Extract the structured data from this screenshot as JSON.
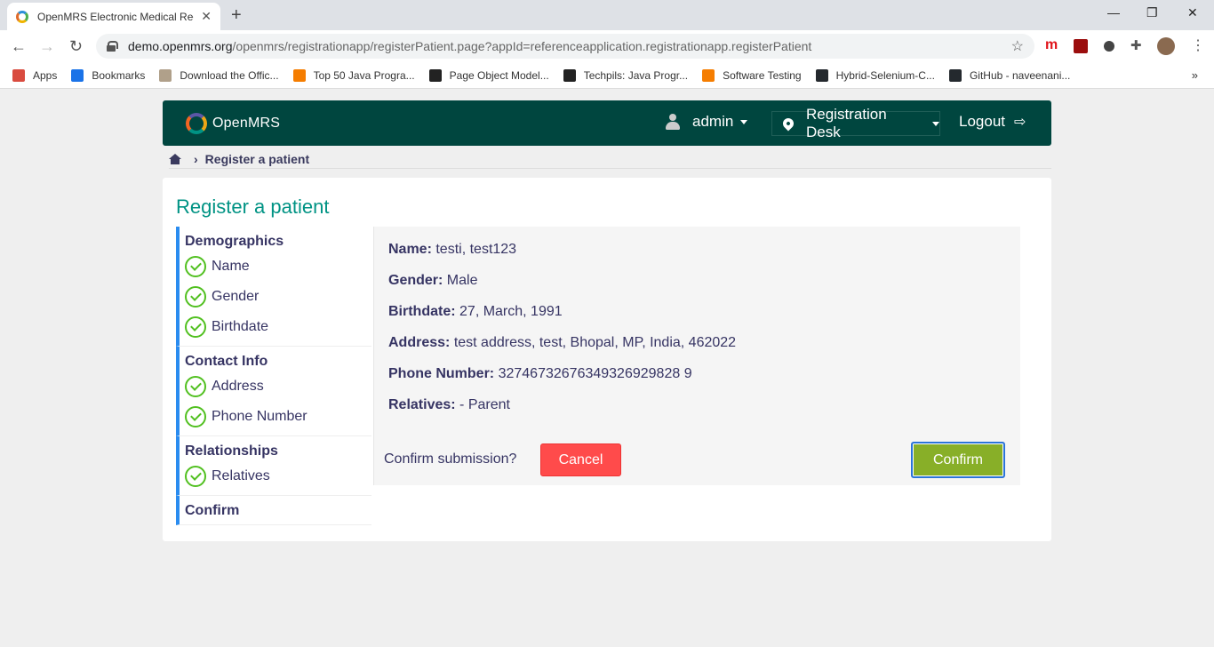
{
  "browser": {
    "tab_title": "OpenMRS Electronic Medical Rec",
    "url_host": "demo.openmrs.org",
    "url_path": "/openmrs/registrationapp/registerPatient.page?appId=referenceapplication.registrationapp.registerPatient",
    "bookmarks": [
      {
        "label": "Apps",
        "icon": "apps-grid-icon",
        "color": "#d94b3f"
      },
      {
        "label": "Bookmarks",
        "icon": "star-icon",
        "color": "#1a73e8"
      },
      {
        "label": "Download the Offic...",
        "icon": "document-icon",
        "color": "#b0a08a"
      },
      {
        "label": "Top 50 Java Progra...",
        "icon": "blogger-icon",
        "color": "#f57d00"
      },
      {
        "label": "Page Object Model...",
        "icon": "8th-icon",
        "color": "#222222"
      },
      {
        "label": "Techpils: Java Progr...",
        "icon": "t-icon",
        "color": "#222222"
      },
      {
        "label": "Software Testing",
        "icon": "blogger-icon",
        "color": "#f57d00"
      },
      {
        "label": "Hybrid-Selenium-C...",
        "icon": "github-icon",
        "color": "#24292e"
      },
      {
        "label": "GitHub - naveenani...",
        "icon": "github-icon",
        "color": "#24292e"
      }
    ]
  },
  "header": {
    "brand": "OpenMRS",
    "user": "admin",
    "location": "Registration Desk",
    "logout": "Logout"
  },
  "breadcrumb": {
    "current": "Register a patient"
  },
  "page": {
    "title": "Register a patient"
  },
  "sidebar": {
    "sections": [
      {
        "title": "Demographics",
        "steps": [
          "Name",
          "Gender",
          "Birthdate"
        ]
      },
      {
        "title": "Contact Info",
        "steps": [
          "Address",
          "Phone Number"
        ]
      },
      {
        "title": "Relationships",
        "steps": [
          "Relatives"
        ]
      },
      {
        "title": "Confirm",
        "steps": []
      }
    ]
  },
  "summary": {
    "fields": [
      {
        "label": "Name:",
        "value": "testi, test123"
      },
      {
        "label": "Gender:",
        "value": "Male"
      },
      {
        "label": "Birthdate:",
        "value": "27, March, 1991"
      },
      {
        "label": "Address:",
        "value": "test address, test, Bhopal, MP, India, 462022"
      },
      {
        "label": "Phone Number:",
        "value": "32746732676349326929828 9"
      },
      {
        "label": "Relatives:",
        "value": "- Parent"
      }
    ],
    "confirm_question": "Confirm submission?",
    "cancel_label": "Cancel",
    "confirm_label": "Confirm"
  },
  "colors": {
    "header_bg": "#00463f",
    "title": "#009384",
    "check": "#51c020",
    "cancel": "#ff4b4b",
    "confirm": "#88af28",
    "sidebar_accent": "#2a8cf0"
  }
}
